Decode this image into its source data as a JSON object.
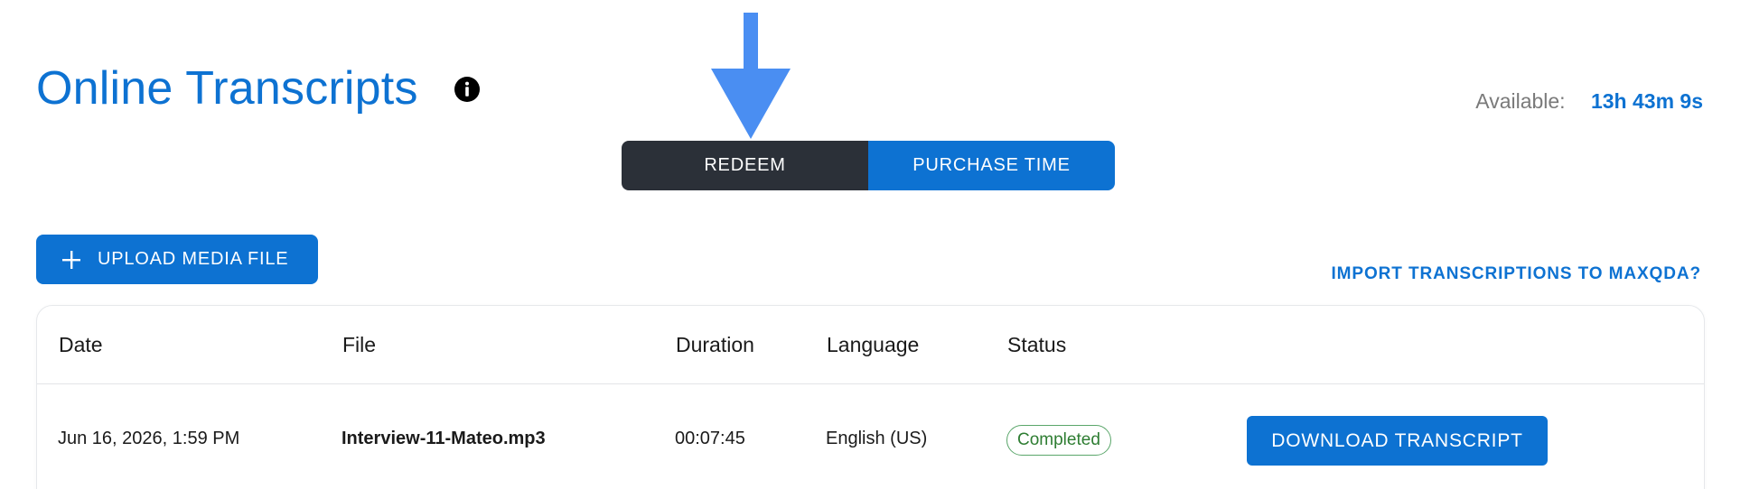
{
  "page": {
    "title": "Online Transcripts",
    "info_icon": "info-icon",
    "annotation_arrow_color": "#4a8ef2"
  },
  "balance": {
    "label": "Available:",
    "value": "13h 43m 9s"
  },
  "actions": {
    "redeem_label": "REDEEM",
    "purchase_label": "PURCHASE TIME",
    "upload_label": "UPLOAD MEDIA FILE",
    "upload_icon": "plus-icon",
    "import_link": "IMPORT TRANSCRIPTIONS TO MAXQDA?"
  },
  "table": {
    "headers": {
      "date": "Date",
      "file": "File",
      "duration": "Duration",
      "language": "Language",
      "status": "Status"
    },
    "rows": [
      {
        "date": "Jun 16, 2026, 1:59 PM",
        "file": "Interview-11-Mateo.mp3",
        "duration": "00:07:45",
        "language": "English (US)",
        "status": "Completed",
        "action": "DOWNLOAD TRANSCRIPT"
      }
    ]
  },
  "colors": {
    "primary": "#0d72d2",
    "dark_button": "#2b3038",
    "status_green": "#2e7d32"
  }
}
